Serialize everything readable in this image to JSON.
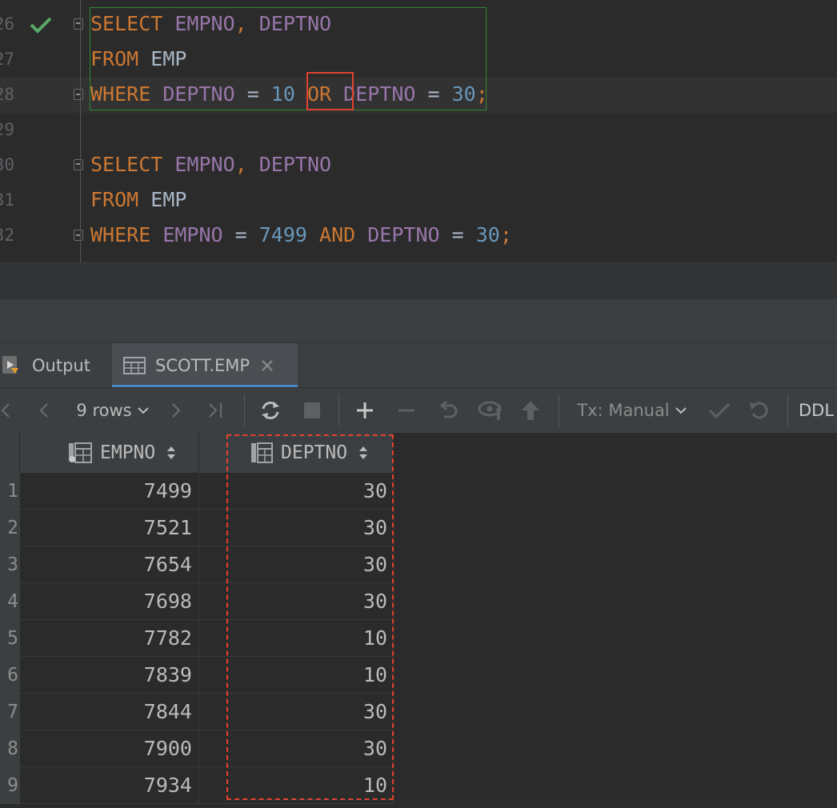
{
  "editor": {
    "lines": [
      {
        "no": "26",
        "tokens": [
          {
            "t": "SELECT",
            "c": "kw"
          },
          {
            "t": " ",
            "c": "plain"
          },
          {
            "t": "EMPNO",
            "c": "col"
          },
          {
            "t": ", ",
            "c": "kw"
          },
          {
            "t": "DEPTNO",
            "c": "col"
          }
        ]
      },
      {
        "no": "27",
        "tokens": [
          {
            "t": "FROM",
            "c": "kw"
          },
          {
            "t": " EMP",
            "c": "plain"
          }
        ]
      },
      {
        "no": "28",
        "tokens": [
          {
            "t": "WHERE",
            "c": "kw"
          },
          {
            "t": " ",
            "c": "plain"
          },
          {
            "t": "DEPTNO",
            "c": "col"
          },
          {
            "t": " = ",
            "c": "plain"
          },
          {
            "t": "10",
            "c": "num"
          },
          {
            "t": " ",
            "c": "plain"
          },
          {
            "t": "OR",
            "c": "kw"
          },
          {
            "t": " ",
            "c": "plain"
          },
          {
            "t": "DEPTNO",
            "c": "col"
          },
          {
            "t": " = ",
            "c": "plain"
          },
          {
            "t": "30",
            "c": "num"
          },
          {
            "t": ";",
            "c": "kw"
          }
        ]
      },
      {
        "no": "29",
        "tokens": []
      },
      {
        "no": "30",
        "tokens": [
          {
            "t": "SELECT",
            "c": "kw"
          },
          {
            "t": " ",
            "c": "plain"
          },
          {
            "t": "EMPNO",
            "c": "col"
          },
          {
            "t": ", ",
            "c": "kw"
          },
          {
            "t": "DEPTNO",
            "c": "col"
          }
        ]
      },
      {
        "no": "31",
        "tokens": [
          {
            "t": "FROM",
            "c": "kw"
          },
          {
            "t": " EMP",
            "c": "plain"
          }
        ]
      },
      {
        "no": "32",
        "tokens": [
          {
            "t": "WHERE",
            "c": "kw"
          },
          {
            "t": " ",
            "c": "plain"
          },
          {
            "t": "EMPNO",
            "c": "col"
          },
          {
            "t": " = ",
            "c": "plain"
          },
          {
            "t": "7499",
            "c": "num"
          },
          {
            "t": " ",
            "c": "plain"
          },
          {
            "t": "AND",
            "c": "kw"
          },
          {
            "t": " ",
            "c": "plain"
          },
          {
            "t": "DEPTNO",
            "c": "col"
          },
          {
            "t": " = ",
            "c": "plain"
          },
          {
            "t": "30",
            "c": "num"
          },
          {
            "t": ";",
            "c": "kw"
          }
        ]
      }
    ],
    "current_line": "28",
    "executed_line": "26"
  },
  "tabs": {
    "output_label": "Output",
    "table_label": "SCOTT.EMP"
  },
  "toolbar": {
    "rows_label": "9 rows",
    "tx_label": "Tx: Manual",
    "ddl_label": "DDL"
  },
  "grid": {
    "columns": [
      "EMPNO",
      "DEPTNO"
    ],
    "rows": [
      {
        "n": "1",
        "empno": "7499",
        "deptno": "30"
      },
      {
        "n": "2",
        "empno": "7521",
        "deptno": "30"
      },
      {
        "n": "3",
        "empno": "7654",
        "deptno": "30"
      },
      {
        "n": "4",
        "empno": "7698",
        "deptno": "30"
      },
      {
        "n": "5",
        "empno": "7782",
        "deptno": "10"
      },
      {
        "n": "6",
        "empno": "7839",
        "deptno": "10"
      },
      {
        "n": "7",
        "empno": "7844",
        "deptno": "30"
      },
      {
        "n": "8",
        "empno": "7900",
        "deptno": "30"
      },
      {
        "n": "9",
        "empno": "7934",
        "deptno": "10"
      }
    ]
  },
  "colors": {
    "keyword": "#cc7832",
    "column": "#9876aa",
    "number": "#6897bb",
    "annotation_red": "#e0432e",
    "selection_green": "#2f8a2f",
    "success_check": "#59a869"
  }
}
